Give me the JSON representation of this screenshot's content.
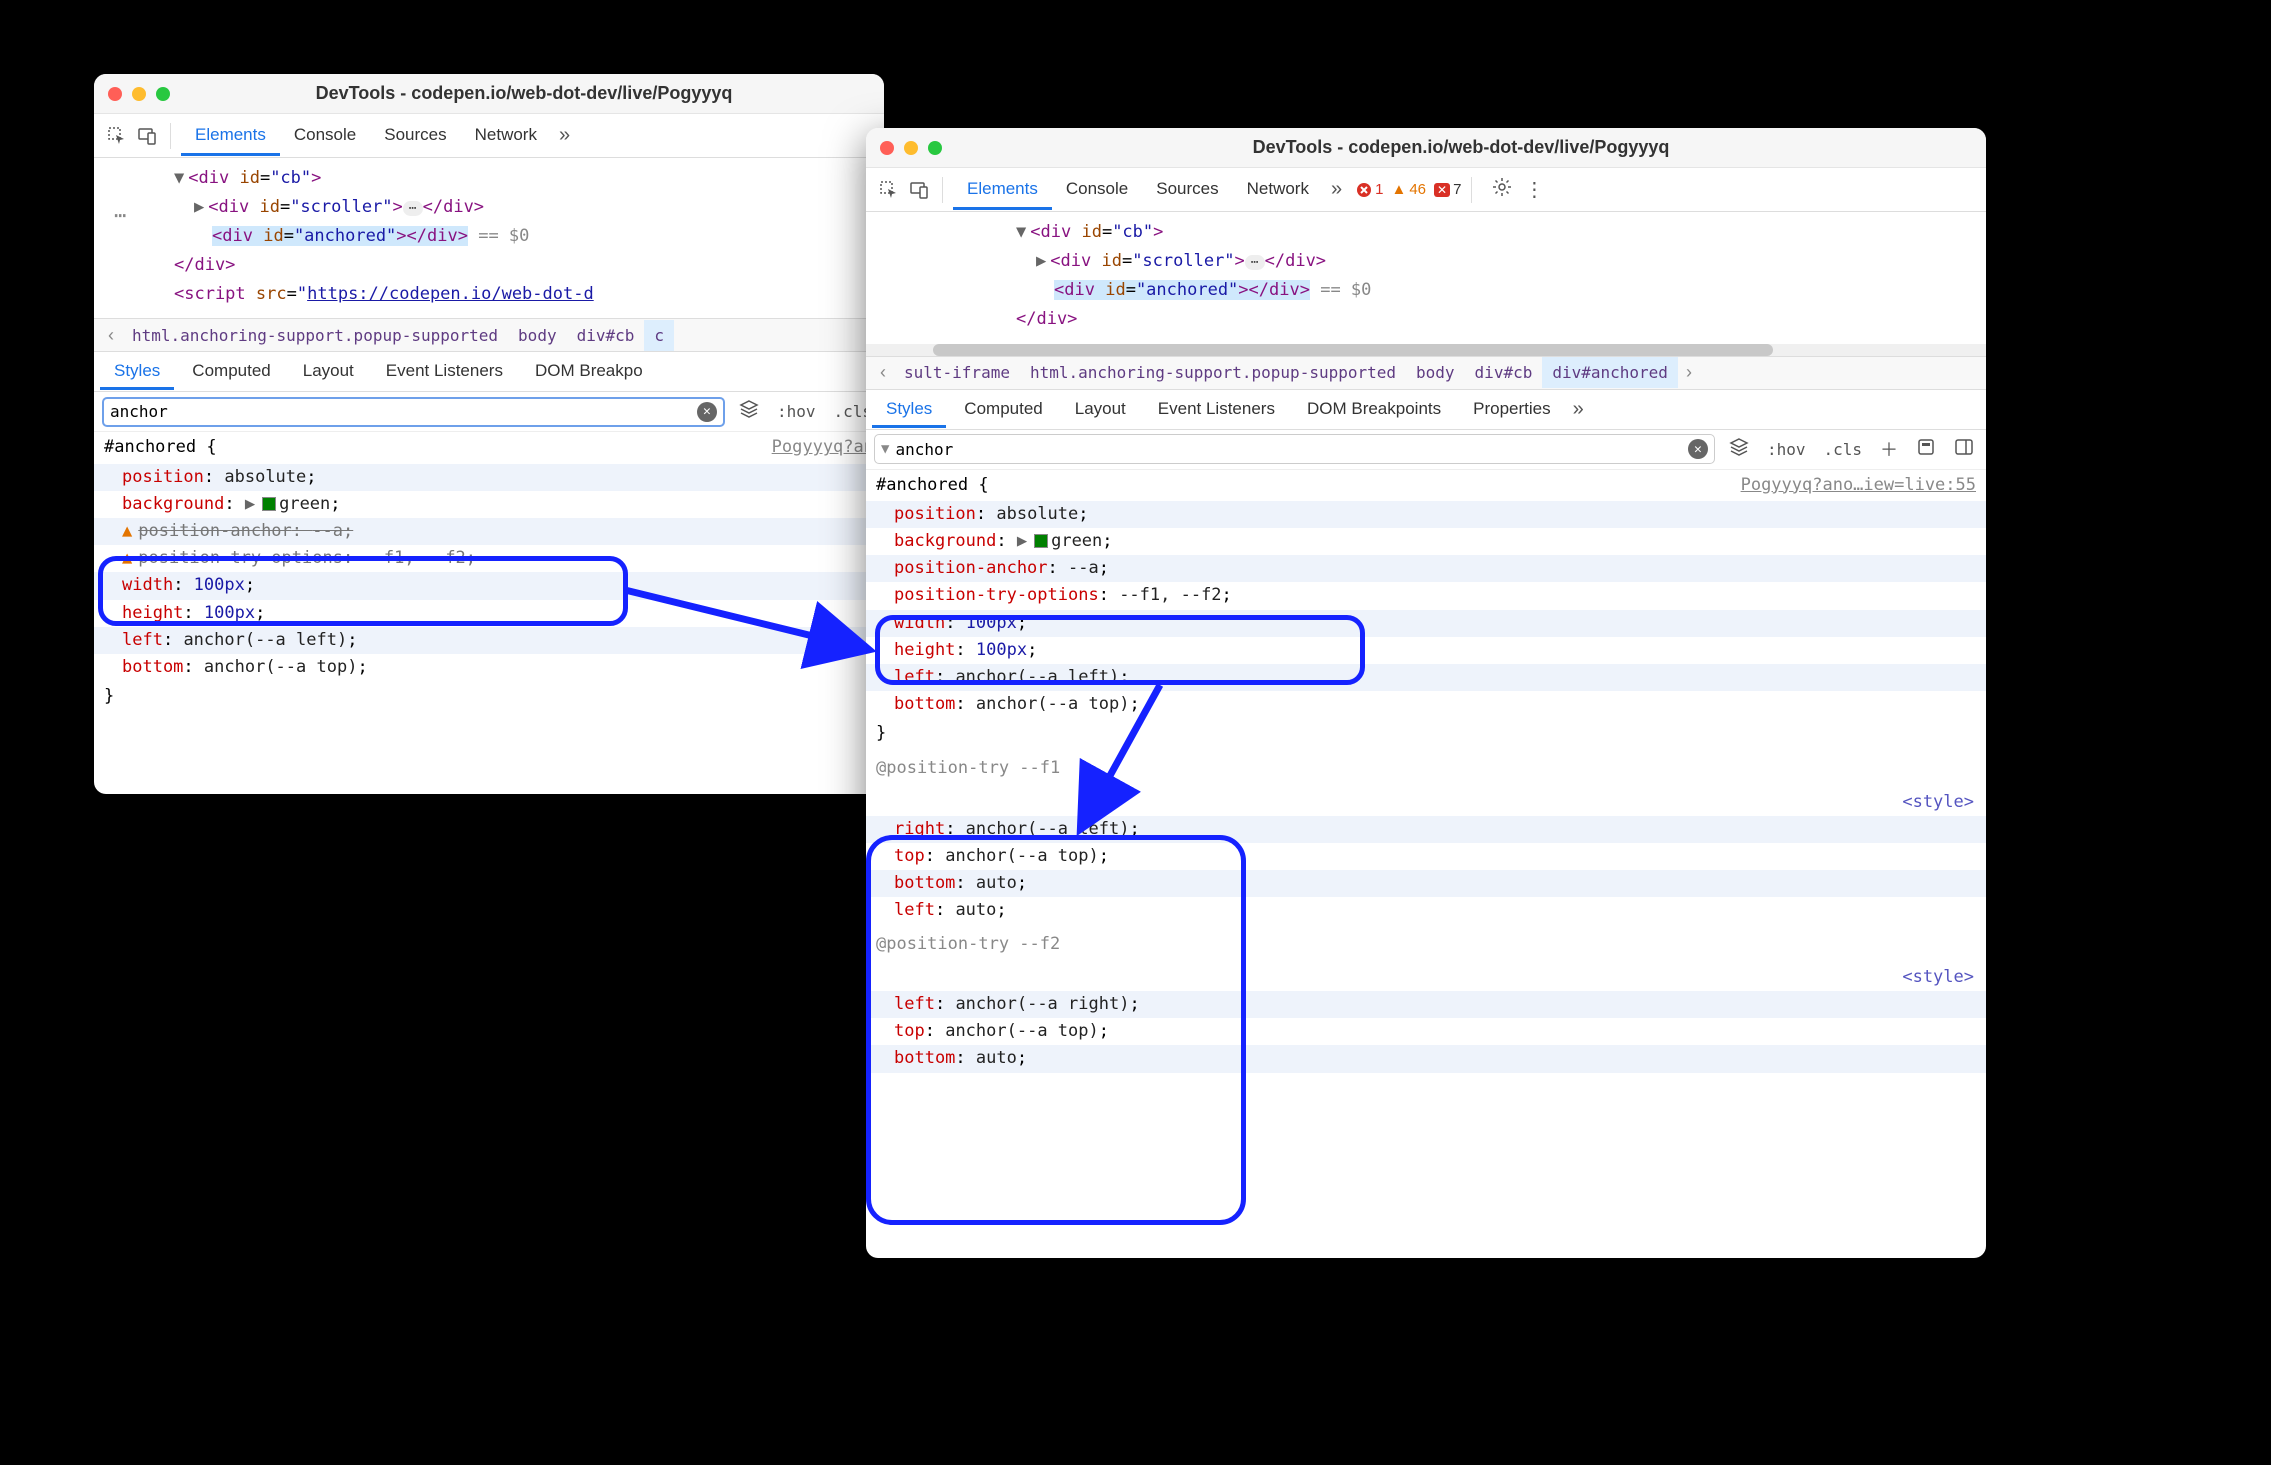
{
  "window_title": "DevTools - codepen.io/web-dot-dev/live/Pogyyyq",
  "main_tabs": [
    "Elements",
    "Console",
    "Sources",
    "Network"
  ],
  "sub_tabs_1": [
    "Styles",
    "Computed",
    "Layout",
    "Event Listeners",
    "DOM Breakpoints"
  ],
  "sub_tabs_2": [
    "Styles",
    "Computed",
    "Layout",
    "Event Listeners",
    "DOM Breakpoints",
    "Properties"
  ],
  "badges": {
    "errors": "1",
    "warnings": "46",
    "fails": "7"
  },
  "filter_text": "anchor",
  "breadcrumb_1": [
    "html.anchoring-support.popup-supported",
    "body",
    "div#cb"
  ],
  "breadcrumb_2": [
    "sult-iframe",
    "html.anchoring-support.popup-supported",
    "body",
    "div#cb",
    "div#anchored"
  ],
  "dom": {
    "l1": "<div id=\"cb\">",
    "l2open": "<div id=\"scroller\">",
    "l2close": "</div>",
    "l3open": "<div id=\"anchored\">",
    "l3close": "</div>",
    "eq": "== $0",
    "close": "</div>",
    "script": "<script src=\"https://codepen.io/web-dot-d"
  },
  "source1": "Pogyyyq?an",
  "source2": "Pogyyyq?ano…iew=live:55",
  "style_label": "<style>",
  "selector": "#anchored {",
  "rules": [
    {
      "name": "position",
      "val": "absolute"
    },
    {
      "name": "background",
      "val": "green",
      "swatch": true,
      "expand": true
    },
    {
      "name": "position-anchor",
      "val": "--a",
      "warn_left": true
    },
    {
      "name": "position-try-options",
      "val": "--f1, --f2",
      "warn_left": true
    },
    {
      "name": "width",
      "val": "100px"
    },
    {
      "name": "height",
      "val": "100px"
    },
    {
      "name": "left",
      "val": "anchor(--a left)"
    },
    {
      "name": "bottom",
      "val": "anchor(--a top)"
    }
  ],
  "close_brace": "}",
  "at1": "@position-try --f1",
  "at1_rules": [
    {
      "name": "right",
      "val": "anchor(--a left)"
    },
    {
      "name": "top",
      "val": "anchor(--a top)"
    },
    {
      "name": "bottom",
      "val": "auto"
    },
    {
      "name": "left",
      "val": "auto"
    }
  ],
  "at2": "@position-try --f2",
  "at2_rules": [
    {
      "name": "left",
      "val": "anchor(--a right)"
    },
    {
      "name": "top",
      "val": "anchor(--a top)"
    },
    {
      "name": "bottom",
      "val": "auto"
    }
  ],
  "labels": {
    "hov": ":hov",
    "cls": ".cls"
  }
}
